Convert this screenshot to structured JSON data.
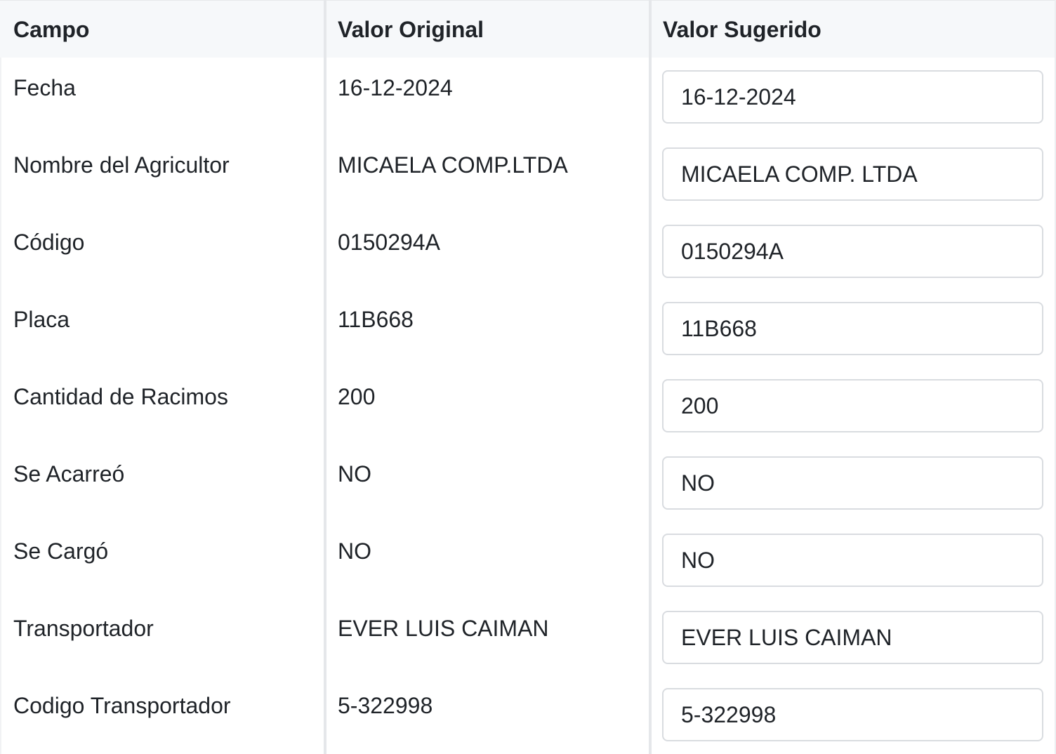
{
  "headers": {
    "campo": "Campo",
    "valor_original": "Valor Original",
    "valor_sugerido": "Valor Sugerido"
  },
  "rows": [
    {
      "campo": "Fecha",
      "original": "16-12-2024",
      "sugerido": "16-12-2024"
    },
    {
      "campo": "Nombre del Agricultor",
      "original": "MICAELA COMP.LTDA",
      "sugerido": "MICAELA COMP. LTDA"
    },
    {
      "campo": "Código",
      "original": "0150294A",
      "sugerido": "0150294A"
    },
    {
      "campo": "Placa",
      "original": "11B668",
      "sugerido": "11B668"
    },
    {
      "campo": "Cantidad de Racimos",
      "original": "200",
      "sugerido": "200"
    },
    {
      "campo": "Se Acarreó",
      "original": "NO",
      "sugerido": "NO"
    },
    {
      "campo": "Se Cargó",
      "original": "NO",
      "sugerido": "NO"
    },
    {
      "campo": "Transportador",
      "original": "EVER LUIS CAIMAN",
      "sugerido": "EVER LUIS CAIMAN"
    },
    {
      "campo": "Codigo Transportador",
      "original": "5-322998",
      "sugerido": "5-322998"
    }
  ],
  "colors": {
    "header_bg": "#f6f8fa",
    "divider": "#e5e7ea",
    "input_border": "#d9dce0",
    "text": "#1f2328"
  }
}
